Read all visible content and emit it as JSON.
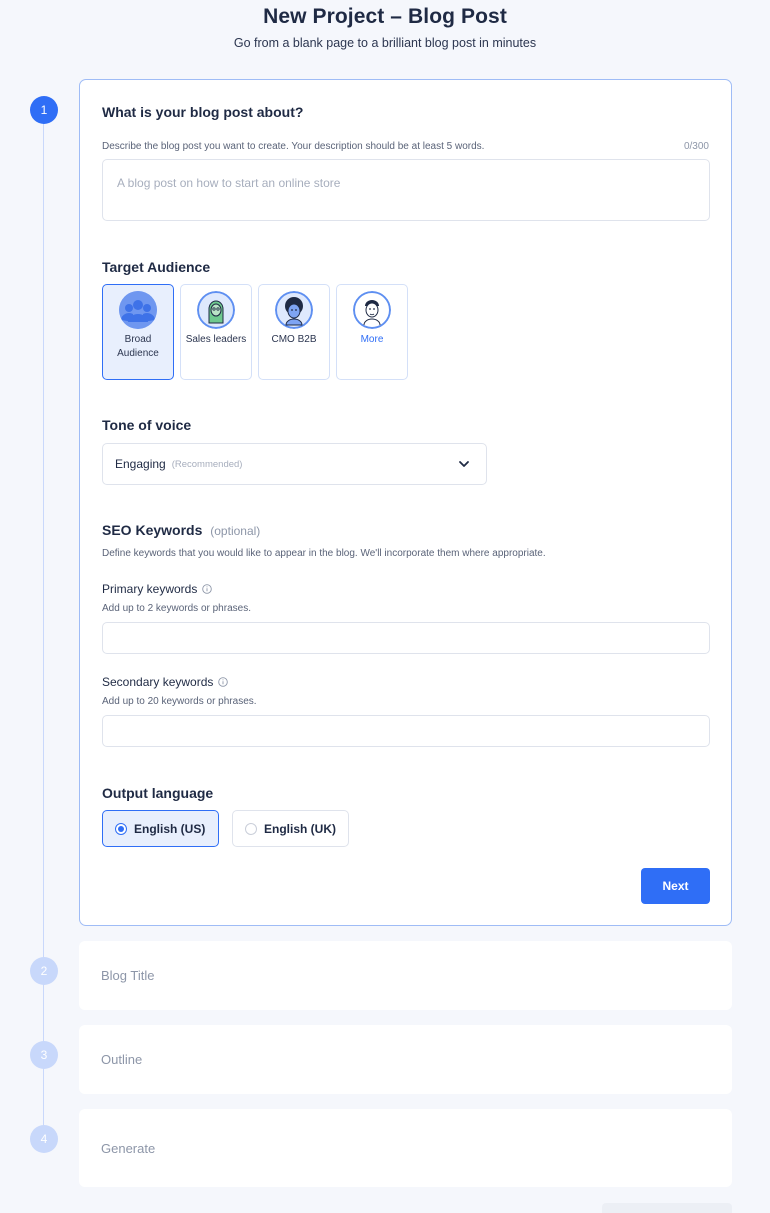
{
  "header": {
    "title": "New Project – Blog Post",
    "subtitle": "Go from a blank page to a brilliant blog post in minutes"
  },
  "steps": [
    {
      "number": "1",
      "state": "active"
    },
    {
      "number": "2",
      "label": "Blog Title",
      "state": "inactive"
    },
    {
      "number": "3",
      "label": "Outline",
      "state": "inactive"
    },
    {
      "number": "4",
      "label": "Generate",
      "state": "inactive"
    }
  ],
  "about": {
    "title": "What is your blog post about?",
    "help": "Describe the blog post you want to create. Your description should be at least 5 words.",
    "counter": "0/300",
    "placeholder": "A blog post on how to start an online store"
  },
  "audience": {
    "title": "Target Audience",
    "options": [
      {
        "label": "Broad Audience",
        "selected": true,
        "icon": "group-avatar-icon"
      },
      {
        "label": "Sales leaders",
        "selected": false,
        "icon": "sales-leader-avatar-icon"
      },
      {
        "label": "CMO B2B",
        "selected": false,
        "icon": "cmo-avatar-icon"
      },
      {
        "label": "More",
        "selected": false,
        "icon": "more-avatar-icon"
      }
    ]
  },
  "tone": {
    "title": "Tone of voice",
    "value": "Engaging",
    "recommended": "(Recommended)"
  },
  "seo": {
    "title": "SEO Keywords",
    "optional": "(optional)",
    "help": "Define keywords that you would like to appear in the blog. We'll incorporate them where appropriate.",
    "primary_label": "Primary keywords",
    "primary_help": "Add up to 2 keywords or phrases.",
    "primary_value": "",
    "secondary_label": "Secondary keywords",
    "secondary_help": "Add up to 20 keywords or phrases.",
    "secondary_value": ""
  },
  "language": {
    "title": "Output language",
    "options": [
      {
        "label": "English (US)",
        "selected": true
      },
      {
        "label": "English (UK)",
        "selected": false
      }
    ]
  },
  "actions": {
    "next_label": "Next"
  },
  "colors": {
    "accent": "#2f6ef6",
    "accent_light": "#e8effd",
    "step_inactive": "#c8d8fb"
  }
}
